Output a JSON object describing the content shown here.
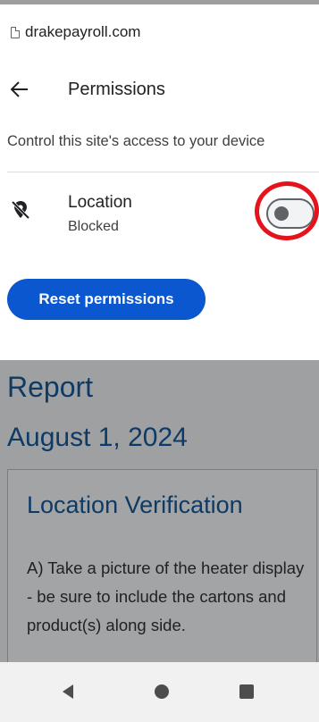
{
  "browser": {
    "domain": "drakepayroll.com"
  },
  "header": {
    "title": "Permissions"
  },
  "description": "Control this site's access to your device",
  "permission": {
    "name": "Location",
    "status": "Blocked",
    "enabled": false
  },
  "reset_button": {
    "label": "Reset permissions"
  },
  "report": {
    "title": "Report",
    "date": "August 1, 2024",
    "card_title": "Location Verification",
    "card_body": "A) Take a picture of the heater display - be sure to include the cartons and product(s) along side."
  },
  "colors": {
    "accent": "#0b57d0",
    "annotation": "#e5131b",
    "report_heading": "#0e3a66"
  },
  "icons": {
    "back": "arrow-left-icon",
    "location": "location-off-icon",
    "page": "page-icon"
  }
}
